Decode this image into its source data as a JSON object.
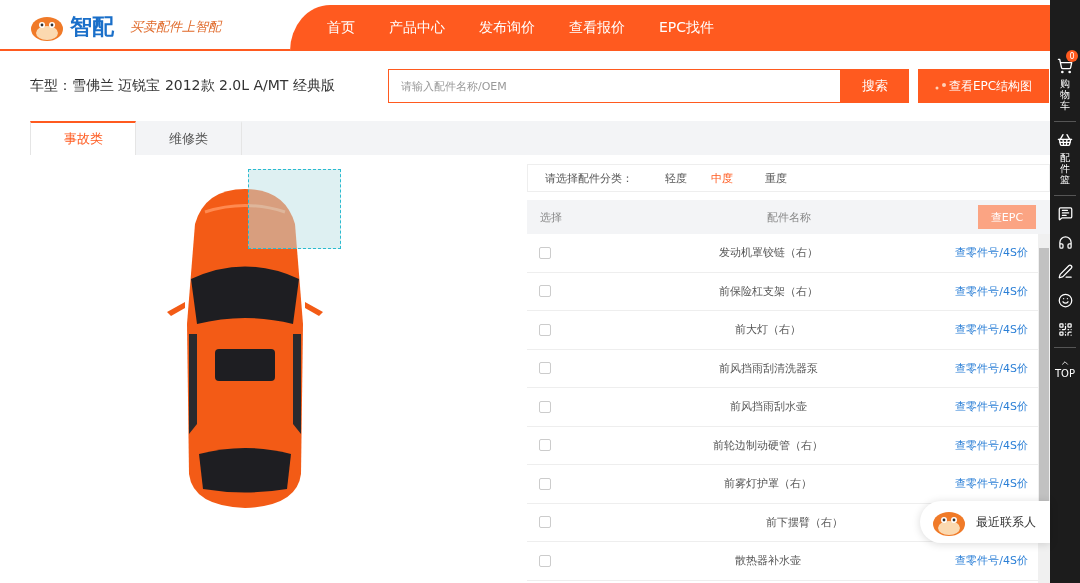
{
  "logo": {
    "name": "智配",
    "slogan": "买卖配件上智配"
  },
  "nav": [
    {
      "label": "首页"
    },
    {
      "label": "产品中心"
    },
    {
      "label": "发布询价"
    },
    {
      "label": "查看报价"
    },
    {
      "label": "EPC找件"
    }
  ],
  "vehicle": "车型：雪佛兰 迈锐宝 2012款 2.0L A/MT 经典版",
  "search": {
    "placeholder": "请输入配件名称/OEM",
    "button": "搜索"
  },
  "epc_button": "查看EPC结构图",
  "tabs": [
    {
      "label": "事故类",
      "selected": true
    },
    {
      "label": "维修类",
      "selected": false
    }
  ],
  "filter": {
    "label": "请选择配件分类：",
    "options": [
      {
        "label": "轻度",
        "selected": false
      },
      {
        "label": "中度",
        "selected": true
      },
      {
        "label": "重度",
        "selected": false
      }
    ]
  },
  "table": {
    "columns": [
      "选择",
      "配件名称"
    ],
    "button": "查EPC",
    "rows": [
      {
        "name": "发动机罩铰链（右）",
        "link": "查零件号/4S价",
        "checked": false
      },
      {
        "name": "前保险杠支架（右）",
        "link": "查零件号/4S价",
        "checked": false
      },
      {
        "name": "前大灯（右）",
        "link": "查零件号/4S价",
        "checked": false
      },
      {
        "name": "前风挡雨刮清洗器泵",
        "link": "查零件号/4S价",
        "checked": false
      },
      {
        "name": "前风挡雨刮水壶",
        "link": "查零件号/4S价",
        "checked": false
      },
      {
        "name": "前轮边制动硬管（右）",
        "link": "查零件号/4S价",
        "checked": false
      },
      {
        "name": "前雾灯护罩（右）",
        "link": "查零件号/4S价",
        "checked": false
      },
      {
        "name": "前下摆臂（右）",
        "checked": false
      },
      {
        "name": "散热器补水壶",
        "link": "查零件号/4S价",
        "checked": false
      }
    ]
  },
  "sidebar": {
    "cart": {
      "count": "0",
      "label": "购物车"
    },
    "basket": "配件篮",
    "top": "TOP"
  },
  "contact": "最近联系人"
}
